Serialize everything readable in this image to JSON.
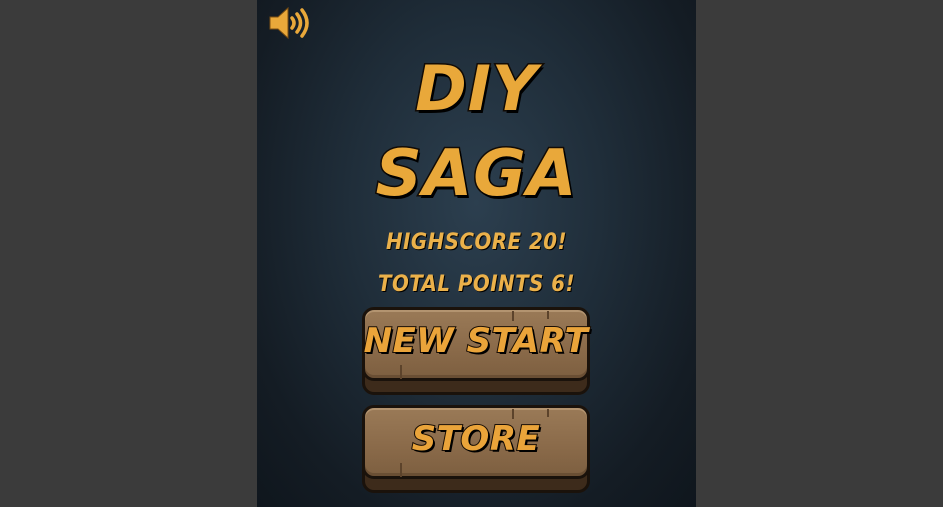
{
  "game": {
    "title_line1": "DIY",
    "title_line2": "SAGA",
    "highscore_text": "HIGHSCORE 20!",
    "total_points_text": "TOTAL POINTS 6!",
    "buttons": {
      "new_start": "NEW START",
      "store": "STORE"
    },
    "sound_icon": "speaker-volume-icon",
    "colors": {
      "accent": "#e9a83a",
      "wood": "#8b6b4a",
      "background": "#1f2d39",
      "outer": "#3b3b3b"
    }
  }
}
